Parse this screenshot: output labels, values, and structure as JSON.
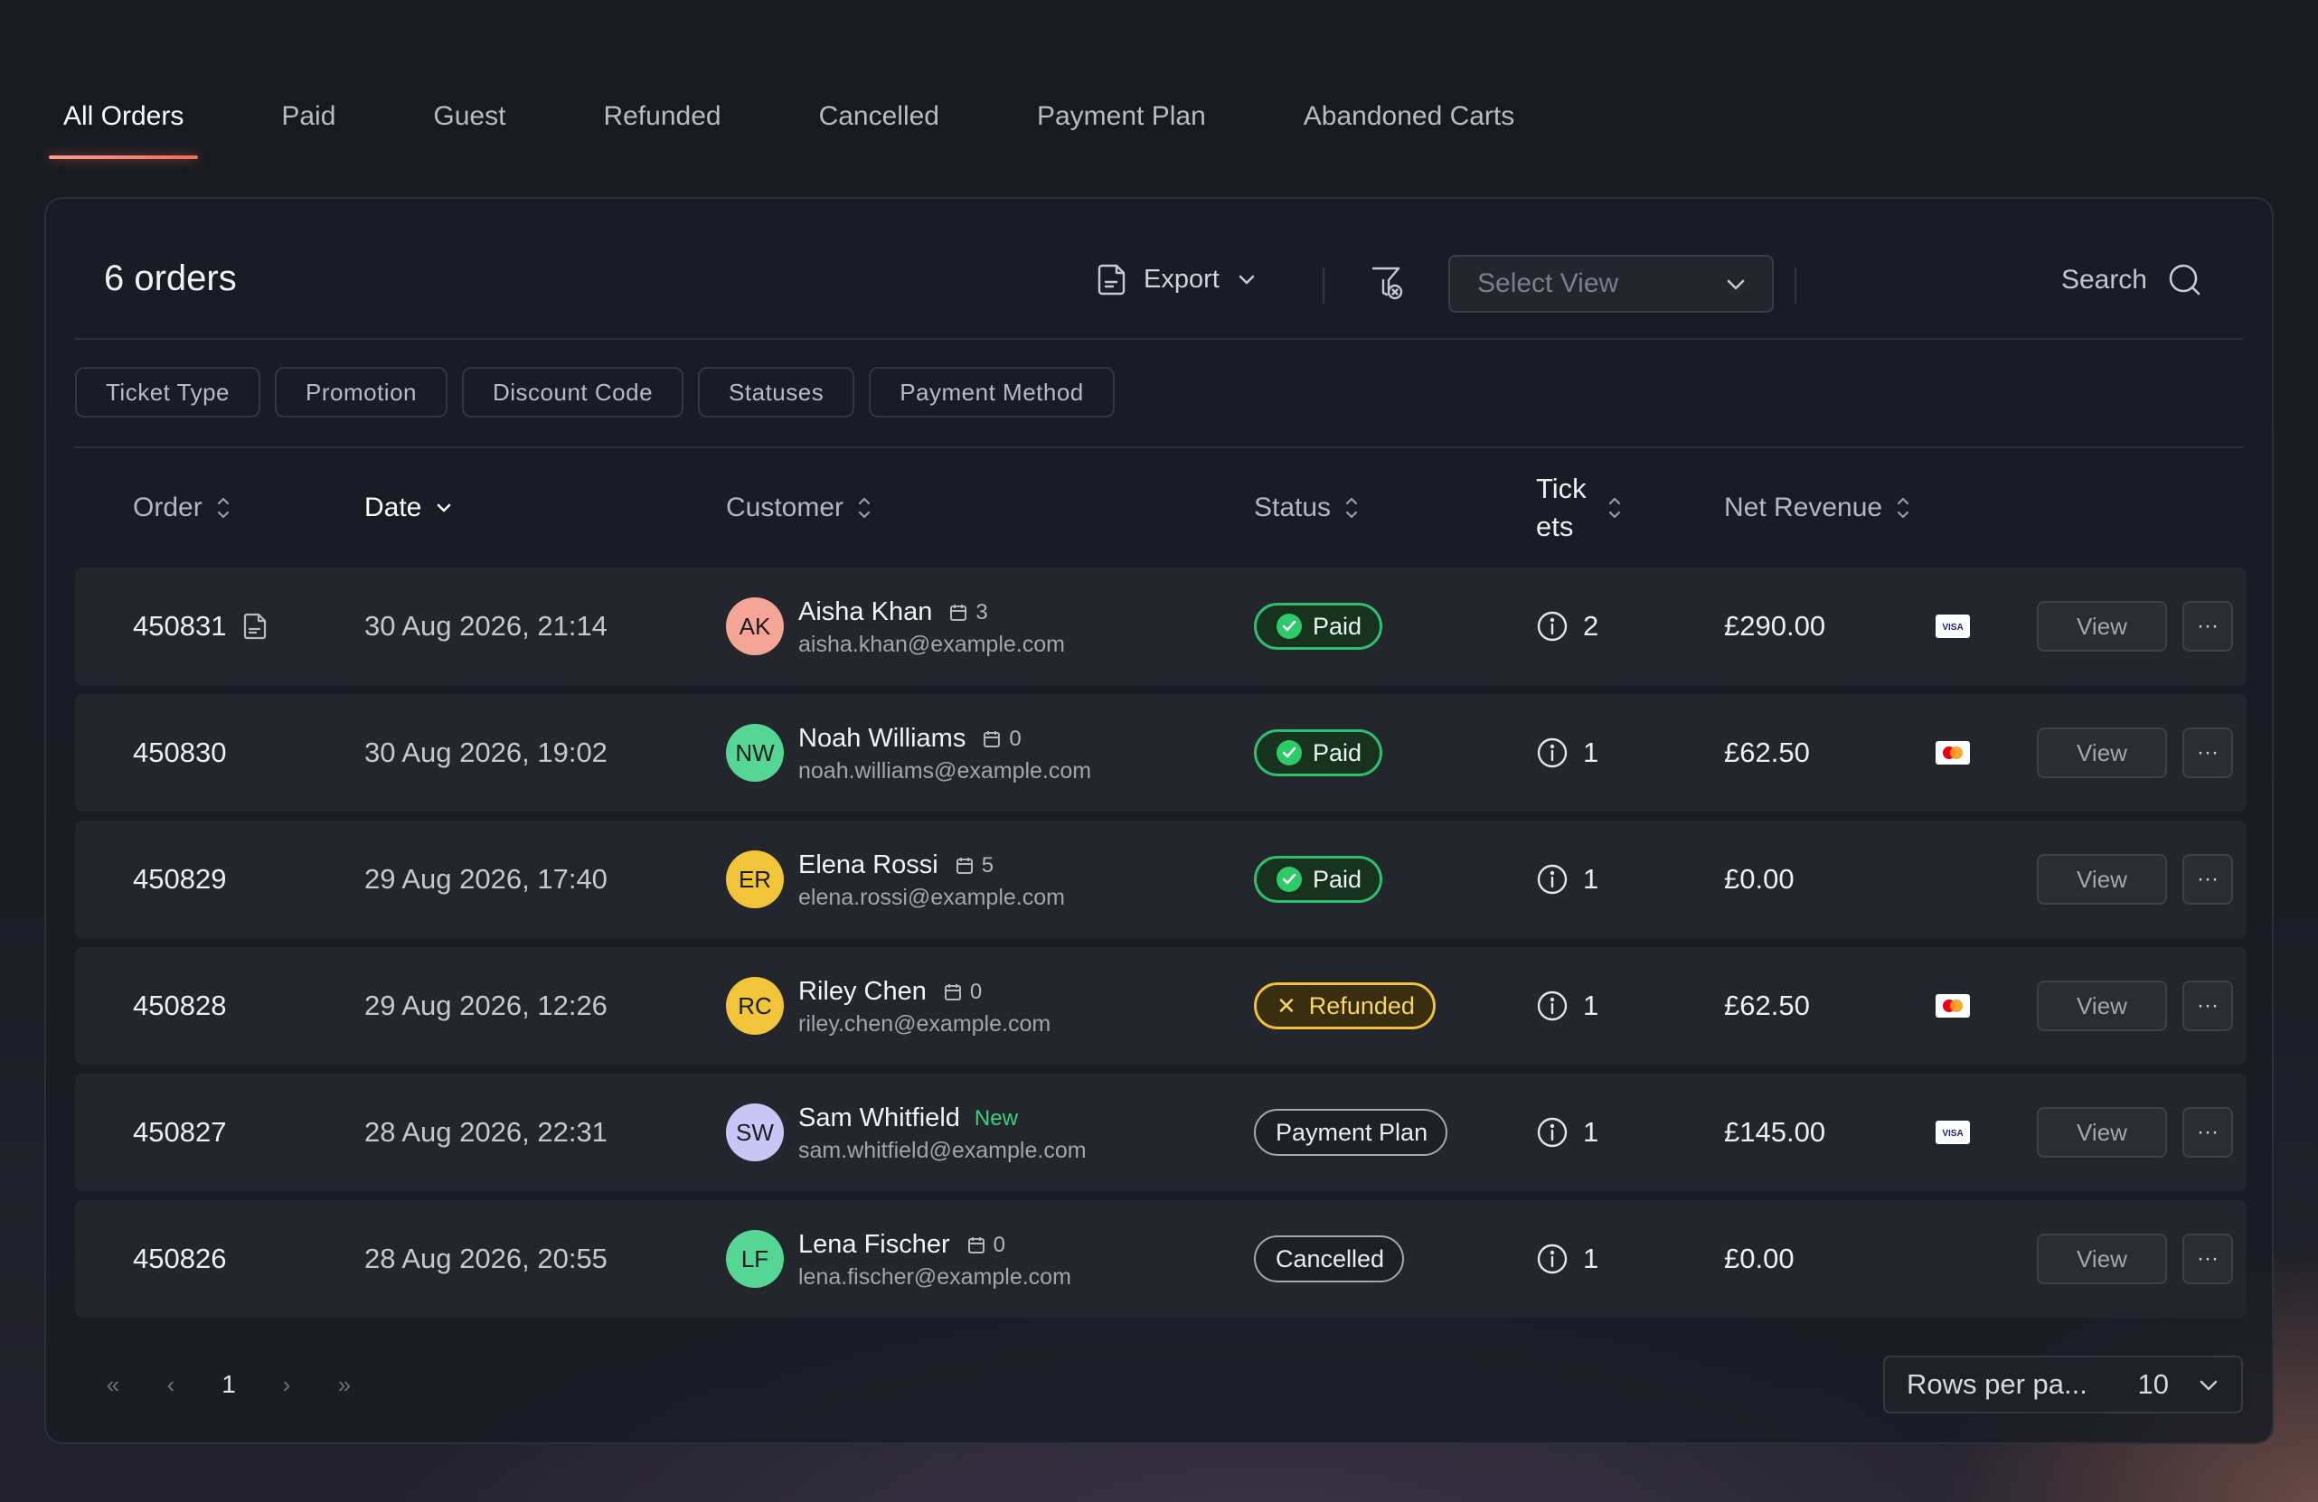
{
  "tabs": [
    {
      "label": "All Orders"
    },
    {
      "label": "Paid"
    },
    {
      "label": "Guest"
    },
    {
      "label": "Refunded"
    },
    {
      "label": "Cancelled"
    },
    {
      "label": "Payment Plan"
    },
    {
      "label": "Abandoned Carts"
    }
  ],
  "toolbar": {
    "count_label": "6 orders",
    "export_label": "Export",
    "select_view_placeholder": "Select View",
    "search_label": "Search"
  },
  "filters": [
    "Ticket Type",
    "Promotion",
    "Discount Code",
    "Statuses",
    "Payment Method"
  ],
  "columns": {
    "order": "Order",
    "date": "Date",
    "customer": "Customer",
    "status": "Status",
    "tickets_line1": "Tick",
    "tickets_line2": "ets",
    "net_revenue": "Net Revenue"
  },
  "rows": [
    {
      "order": "450831",
      "has_doc": true,
      "date": "30 Aug 2026, 21:14",
      "initials": "AK",
      "avatar_color": "#f4a596",
      "name": "Aisha Khan",
      "badge_count": "3",
      "is_new": false,
      "email": "aisha.khan@example.com",
      "status": "Paid",
      "status_kind": "paid",
      "tickets": "2",
      "revenue": "£290.00",
      "card": "visa",
      "view": "View",
      "more": "···"
    },
    {
      "order": "450830",
      "has_doc": false,
      "date": "30 Aug 2026, 19:02",
      "initials": "NW",
      "avatar_color": "#55d694",
      "name": "Noah Williams",
      "badge_count": "0",
      "is_new": false,
      "email": "noah.williams@example.com",
      "status": "Paid",
      "status_kind": "paid",
      "tickets": "1",
      "revenue": "£62.50",
      "card": "mastercard",
      "view": "View",
      "more": "···"
    },
    {
      "order": "450829",
      "has_doc": false,
      "date": "29 Aug 2026, 17:40",
      "initials": "ER",
      "avatar_color": "#f1c43a",
      "name": "Elena Rossi",
      "badge_count": "5",
      "is_new": false,
      "email": "elena.rossi@example.com",
      "status": "Paid",
      "status_kind": "paid",
      "tickets": "1",
      "revenue": "£0.00",
      "card": "",
      "view": "View",
      "more": "···"
    },
    {
      "order": "450828",
      "has_doc": false,
      "date": "29 Aug 2026, 12:26",
      "initials": "RC",
      "avatar_color": "#f1c43a",
      "name": "Riley Chen",
      "badge_count": "0",
      "is_new": false,
      "email": "riley.chen@example.com",
      "status": "Refunded",
      "status_kind": "refunded",
      "tickets": "1",
      "revenue": "£62.50",
      "card": "mastercard",
      "view": "View",
      "more": "···"
    },
    {
      "order": "450827",
      "has_doc": false,
      "date": "28 Aug 2026, 22:31",
      "initials": "SW",
      "avatar_color": "#c8c6f4",
      "name": "Sam Whitfield",
      "badge_count": "",
      "is_new": true,
      "new_label": "New",
      "email": "sam.whitfield@example.com",
      "status": "Payment Plan",
      "status_kind": "plain",
      "tickets": "1",
      "revenue": "£145.00",
      "card": "visa",
      "view": "View",
      "more": "···"
    },
    {
      "order": "450826",
      "has_doc": false,
      "date": "28 Aug 2026, 20:55",
      "initials": "LF",
      "avatar_color": "#55d694",
      "name": "Lena Fischer",
      "badge_count": "0",
      "is_new": false,
      "email": "lena.fischer@example.com",
      "status": "Cancelled",
      "status_kind": "plain",
      "tickets": "1",
      "revenue": "£0.00",
      "card": "",
      "view": "View",
      "more": "···"
    }
  ],
  "pagination": {
    "first": "«",
    "prev": "‹",
    "current": "1",
    "next": "›",
    "last": "»",
    "rows_per_page_label": "Rows per pa...",
    "rows_per_page_value": "10"
  },
  "colors": {
    "accent": "#f06c5a",
    "paid": "#2fc06c",
    "refunded": "#f1c236",
    "new": "#3ed07a"
  }
}
